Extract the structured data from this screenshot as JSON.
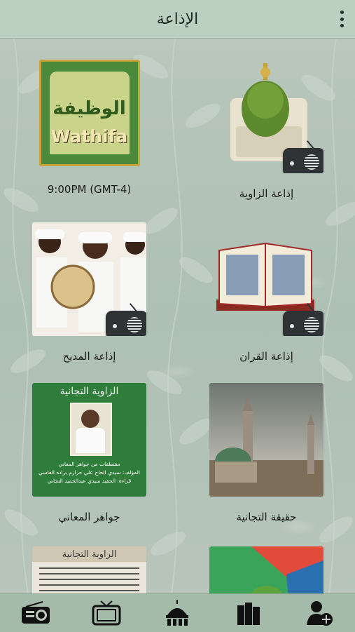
{
  "header": {
    "title": "الإذاعة",
    "menu_icon": "more-vertical-icon"
  },
  "tiles": [
    {
      "caption": "إذاعة الزاوية",
      "icon": "dome-radio-icon"
    },
    {
      "caption": "9:00PM (GMT-4)",
      "icon": "wathifa-logo",
      "image_text_ar": "الوظيفة",
      "image_text_en": "Wathifa"
    },
    {
      "caption": "إذاعة القران",
      "icon": "quran-radio-icon"
    },
    {
      "caption": "إذاعة المديح",
      "icon": "madih-radio-icon"
    },
    {
      "caption": "حقيقة التجانية",
      "icon": "mosque-image"
    },
    {
      "caption": "جواهر المعاني",
      "icon": "book-cover-image",
      "cover_title": "الزاوية التجانية",
      "cover_lines": [
        "مقتطفات من جواهر المعاني",
        "المؤلف: سيدي الحاج علي حرازم براده الفاسي",
        "قراءة: الحفيد سيدي عبدالحميد التجاني"
      ]
    },
    {
      "caption": "",
      "icon": "abstract-image"
    },
    {
      "caption": "",
      "icon": "zawiya-text-image",
      "cover_title": "الزاوية التجانية"
    }
  ],
  "bottom_nav": [
    {
      "name": "radio",
      "icon": "radio-icon"
    },
    {
      "name": "tv",
      "icon": "tv-icon"
    },
    {
      "name": "mosque",
      "icon": "mosque-icon"
    },
    {
      "name": "books",
      "icon": "books-icon"
    },
    {
      "name": "add-user",
      "icon": "add-user-icon"
    }
  ],
  "colors": {
    "header_bg": "#bcd0bf",
    "bottom_bg": "#a5bba9",
    "badge": "#2f3336"
  }
}
